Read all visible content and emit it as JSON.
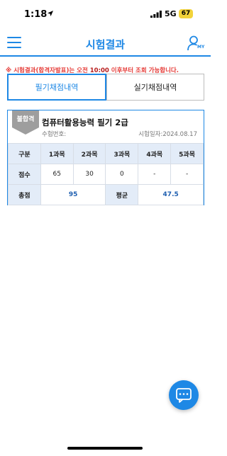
{
  "status_bar": {
    "time": "1:18",
    "network": "5G",
    "battery": "67"
  },
  "header": {
    "title": "시험결과",
    "my_label": "MY"
  },
  "notice": {
    "part1": "※ 시험결과(합격자발표)는 오전 ",
    "highlight": "10:00",
    "part2": " 이후부터 조회 가능합니다."
  },
  "tabs": [
    {
      "label": "필기채점내역",
      "active": true
    },
    {
      "label": "실기채점내역",
      "active": false
    }
  ],
  "result": {
    "badge": "불합격",
    "exam_name": "컴퓨터활용능력 필기 2급",
    "exam_no_label": "수험번호:",
    "exam_date": "시험일자:2024.08.17",
    "columns": [
      "구분",
      "1과목",
      "2과목",
      "3과목",
      "4과목",
      "5과목"
    ],
    "score_row": [
      "점수",
      "65",
      "30",
      "0",
      "-",
      "-"
    ],
    "total_label": "총점",
    "total_value": "95",
    "average_label": "평균",
    "average_value": "47.5"
  },
  "colors": {
    "accent": "#1e88e5",
    "notice": "#e53935",
    "badge": "#9e9e9e"
  },
  "icons": [
    "location-arrow-icon",
    "signal-icon",
    "menu-icon",
    "user-my-icon",
    "chat-icon"
  ]
}
